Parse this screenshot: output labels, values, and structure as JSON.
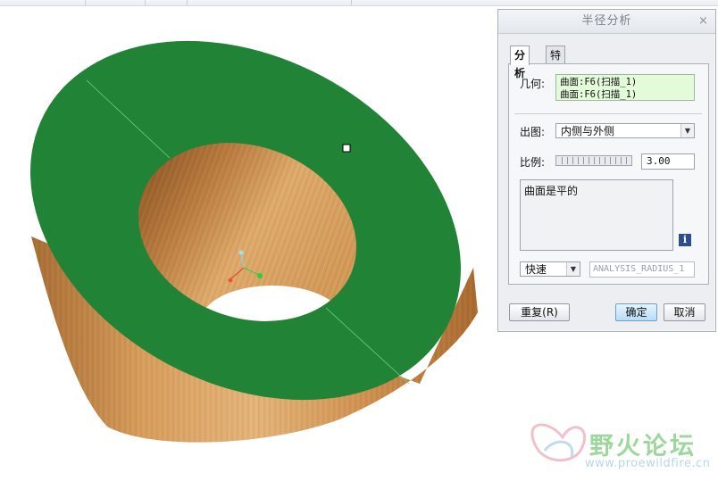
{
  "dialog": {
    "title": "半径分析",
    "close_glyph": "×",
    "tabs": [
      {
        "label": "分析",
        "active": true
      },
      {
        "label": "特征",
        "active": false
      }
    ],
    "geometry": {
      "label": "几何:",
      "refs": [
        "曲面:F6(扫描_1)",
        "曲面:F6(扫描_1)"
      ]
    },
    "output": {
      "label": "出图:",
      "value": "内侧与外侧"
    },
    "scale": {
      "label": "比例:",
      "value": "3.00"
    },
    "result_text": "曲面是平的",
    "info_icon": "info-icon",
    "mode": {
      "value": "快速"
    },
    "feature_name_placeholder": "ANALYSIS_RADIUS_1",
    "buttons": {
      "repeat": "重复(R)",
      "ok": "确定",
      "cancel": "取消"
    }
  },
  "watermark": {
    "text": "野火论坛",
    "url": "www.proewildfire.cn"
  },
  "colors": {
    "surface_green": "#218336",
    "wood": "#c88a4a",
    "dialog_bg": "#eceef2"
  }
}
